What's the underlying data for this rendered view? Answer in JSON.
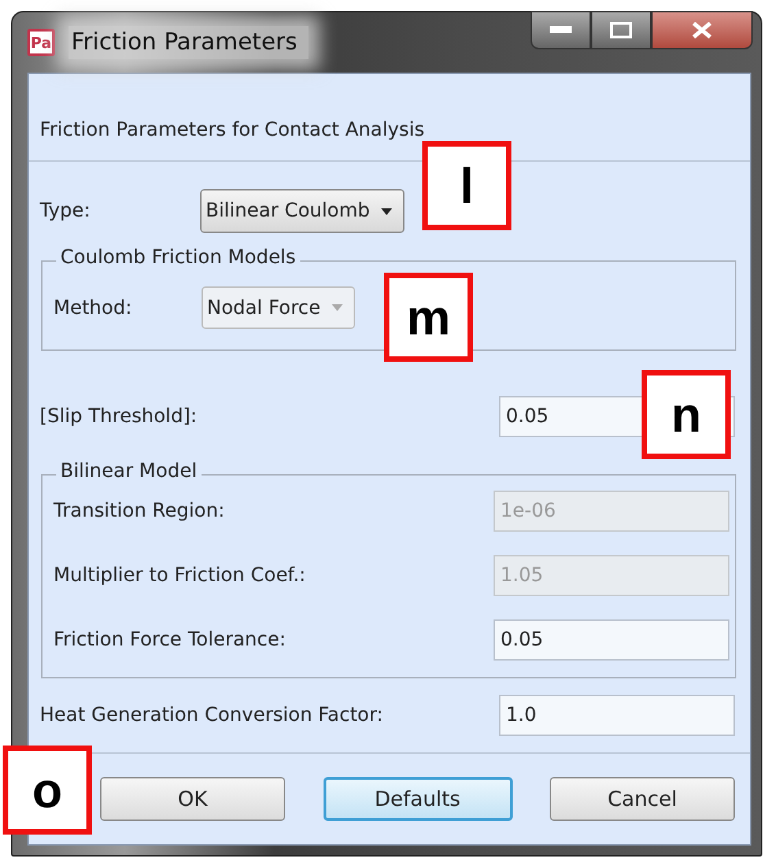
{
  "window": {
    "title": "Friction Parameters",
    "app_icon_text": "Pa"
  },
  "heading": "Friction Parameters for Contact Analysis",
  "type": {
    "label": "Type:",
    "value": "Bilinear Coulomb",
    "disabled": false
  },
  "coulomb_group": {
    "title": "Coulomb Friction Models",
    "method": {
      "label": "Method:",
      "value": "Nodal Force",
      "disabled": true
    }
  },
  "slip_threshold": {
    "label": "[Slip Threshold]:",
    "value": "0.05",
    "disabled": false
  },
  "bilinear_group": {
    "title": "Bilinear Model",
    "fields": [
      {
        "label": "Transition Region:",
        "value": "1e-06",
        "disabled": true
      },
      {
        "label": "Multiplier to Friction Coef.:",
        "value": "1.05",
        "disabled": true
      },
      {
        "label": "Friction Force Tolerance:",
        "value": "0.05",
        "disabled": false
      }
    ]
  },
  "heat_factor": {
    "label": "Heat Generation Conversion Factor:",
    "value": "1.0",
    "disabled": false
  },
  "buttons": [
    {
      "label": "OK",
      "focused": false
    },
    {
      "label": "Defaults",
      "focused": true
    },
    {
      "label": "Cancel",
      "focused": false
    }
  ],
  "callouts": [
    "l",
    "m",
    "n",
    "o"
  ]
}
